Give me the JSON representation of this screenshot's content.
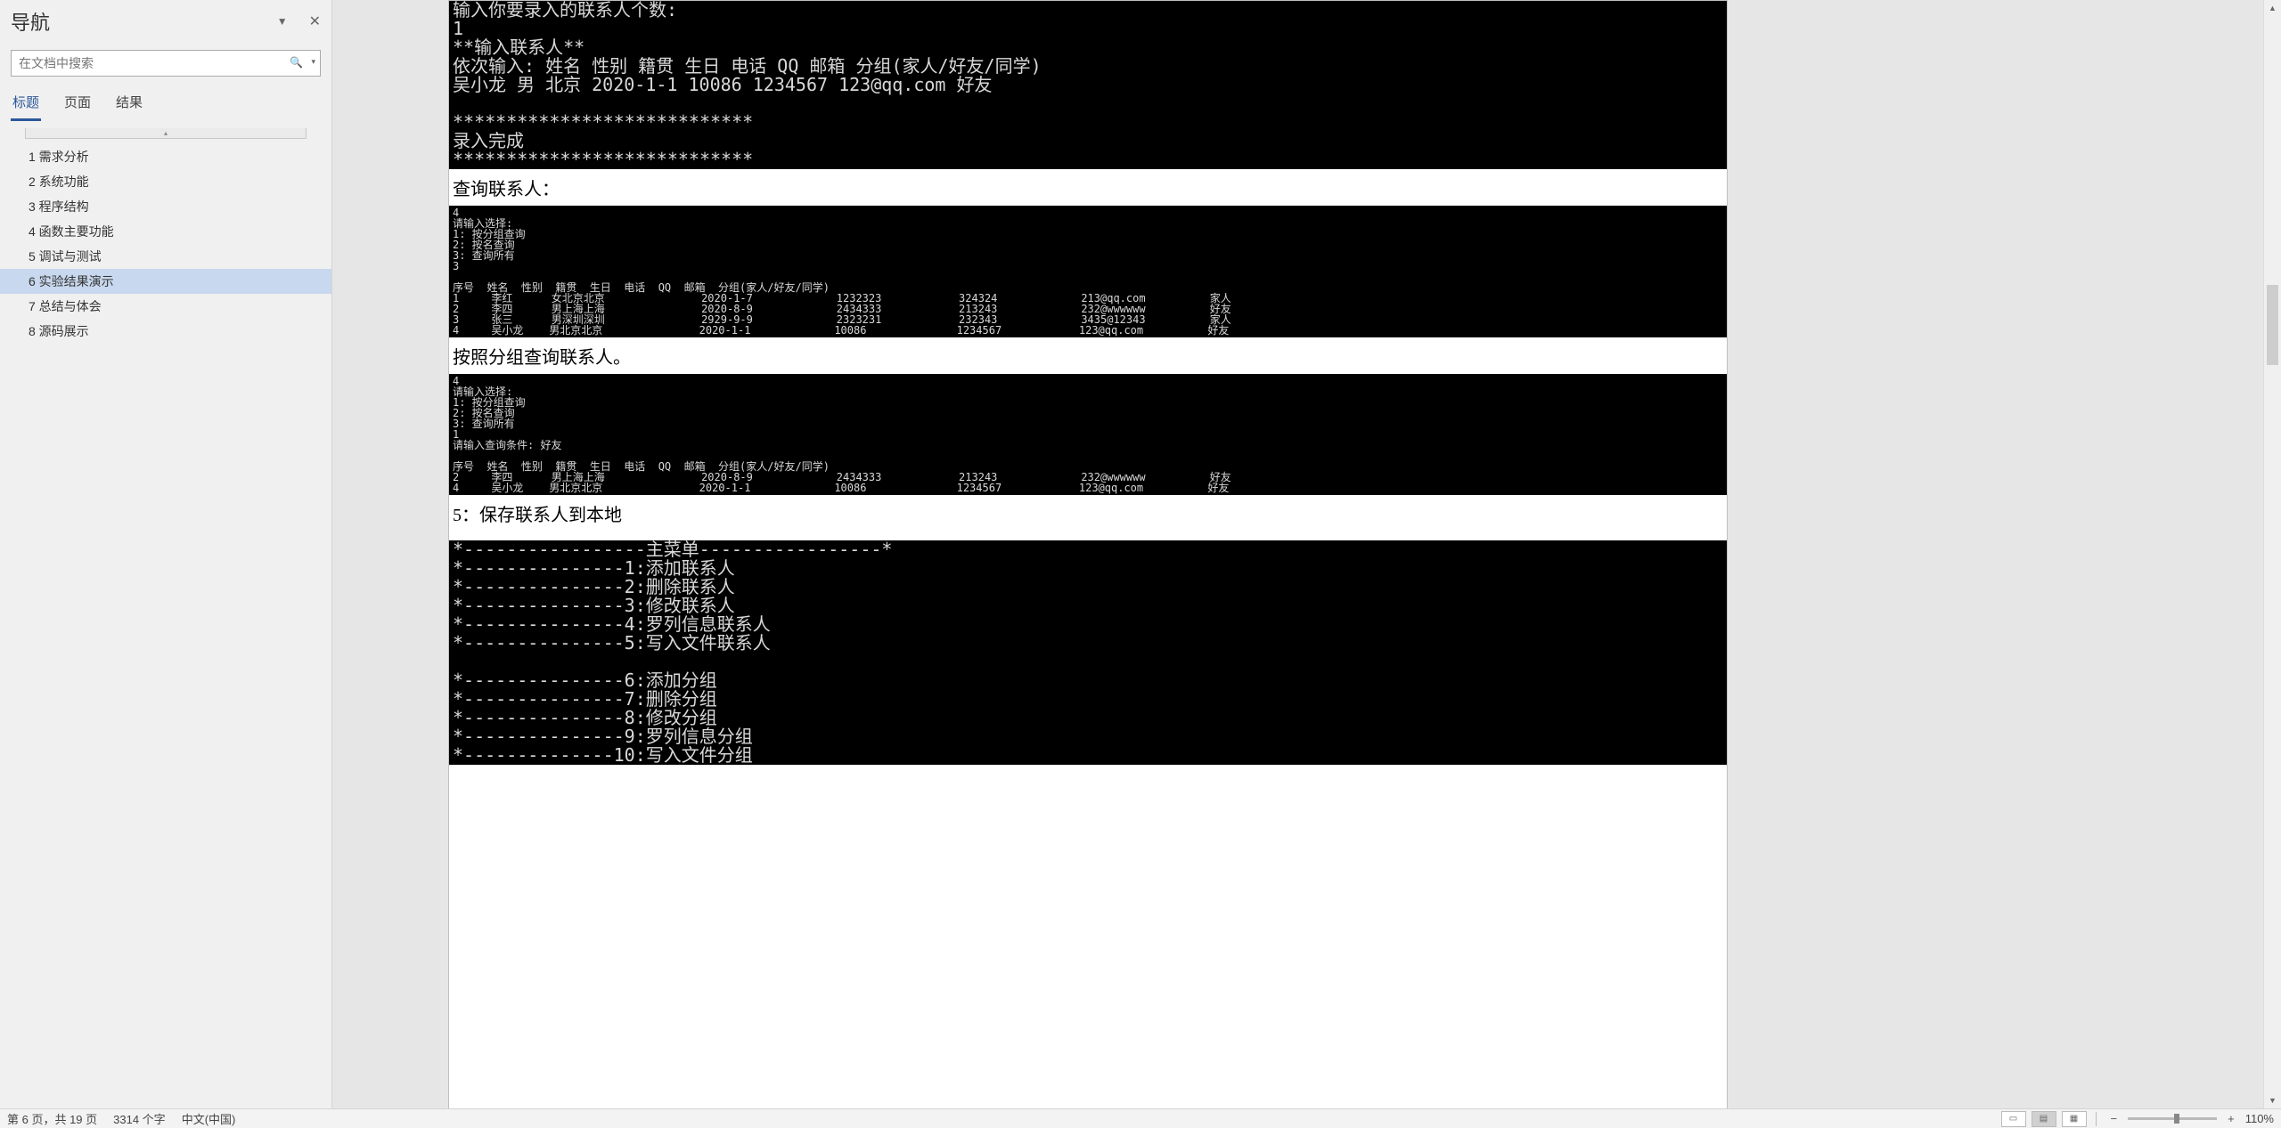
{
  "nav": {
    "title": "导航",
    "search_placeholder": "在文档中搜索",
    "tabs": [
      {
        "label": "标题",
        "active": true
      },
      {
        "label": "页面",
        "active": false
      },
      {
        "label": "结果",
        "active": false
      }
    ],
    "items": [
      {
        "label": "1 需求分析"
      },
      {
        "label": "2 系统功能"
      },
      {
        "label": "3 程序结构"
      },
      {
        "label": "4 函数主要功能"
      },
      {
        "label": "5 调试与测试"
      },
      {
        "label": "6 实验结果演示",
        "selected": true
      },
      {
        "label": "7 总结与体会"
      },
      {
        "label": "8 源码展示"
      }
    ]
  },
  "doc": {
    "block1": "输入你要录入的联系人个数:\n1\n**输入联系人**\n依次输入: 姓名 性别 籍贯 生日 电话 QQ 邮箱 分组(家人/好友/同学)\n吴小龙 男 北京 2020-1-1 10086 1234567 123@qq.com 好友\n\n****************************\n录入完成\n****************************",
    "text1": "查询联系人：",
    "block2": "4\n请输入选择:\n1: 按分组查询\n2: 按名查询\n3: 查询所有\n3\n\n序号  姓名  性别  籍贯  生日  电话  QQ  邮箱  分组(家人/好友/同学)\n1     李红      女北京北京               2020-1-7             1232323            324324             213@qq.com          家人\n2     李四      男上海上海               2020-8-9             2434333            213243             232@wwwwww          好友\n3     张三      男深圳深圳               2929-9-9             2323231            232343             3435@12343          家人\n4     吴小龙    男北京北京               2020-1-1             10086              1234567            123@qq.com          好友",
    "text2": "按照分组查询联系人。",
    "block3": "4\n请输入选择:\n1: 按分组查询\n2: 按名查询\n3: 查询所有\n1\n请输入查询条件: 好友\n\n序号  姓名  性别  籍贯  生日  电话  QQ  邮箱  分组(家人/好友/同学)\n2     李四      男上海上海               2020-8-9             2434333            213243             232@wwwwww          好友\n4     吴小龙    男北京北京               2020-1-1             10086              1234567            123@qq.com          好友",
    "text3": "5：保存联系人到本地",
    "block4": "*-----------------主菜单-----------------*\n*---------------1:添加联系人\n*---------------2:删除联系人\n*---------------3:修改联系人\n*---------------4:罗列信息联系人\n*---------------5:写入文件联系人\n\n*---------------6:添加分组\n*---------------7:删除分组\n*---------------8:修改分组\n*---------------9:罗列信息分组\n*--------------10:写入文件分组"
  },
  "status": {
    "page": "第 6 页，共 19 页",
    "words": "3314 个字",
    "lang": "中文(中国)",
    "zoom": "110%"
  }
}
